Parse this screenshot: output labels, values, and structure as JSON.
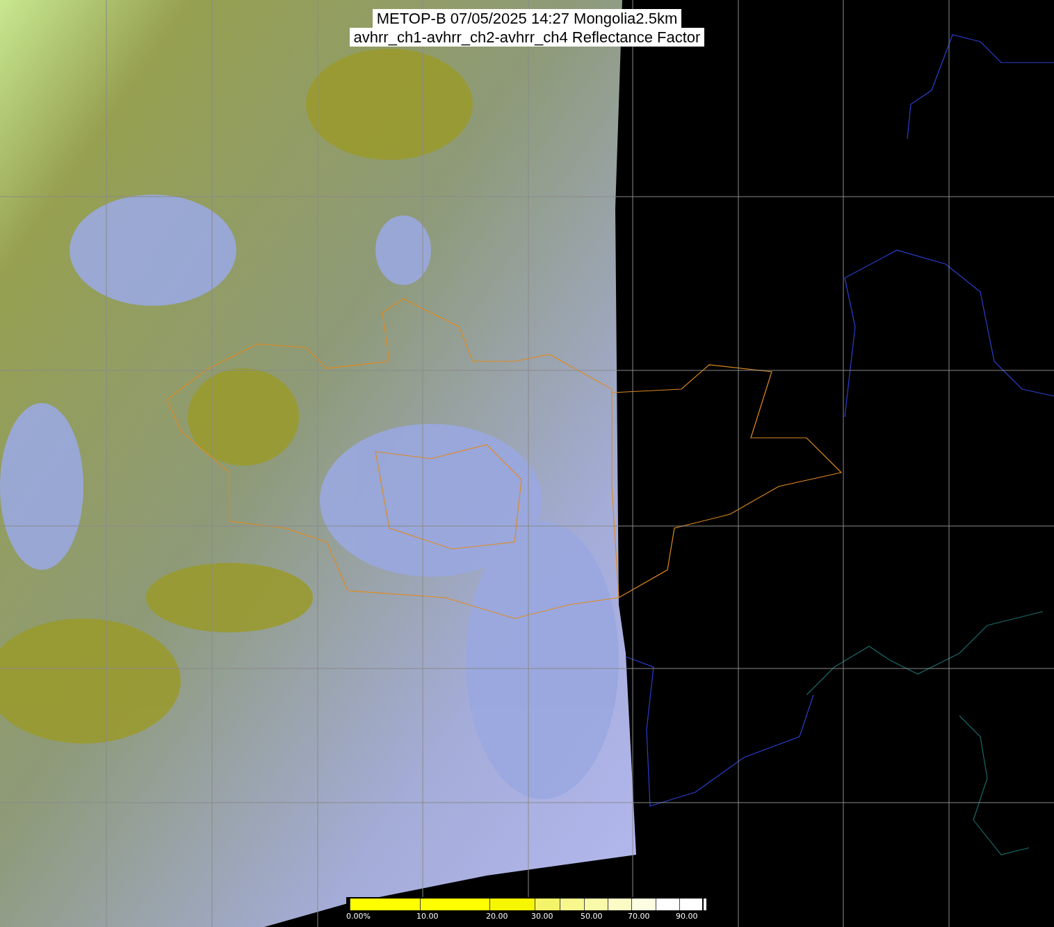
{
  "title": {
    "lines": [
      "METOP-B 07/05/2025 14:27 Mongolia2.5km",
      "avhrr_ch1-avhrr_ch2-avhrr_ch4 Reflectance Factor"
    ]
  },
  "colorbar": {
    "segments": [
      {
        "color": "#ffff00",
        "label": "0.00%"
      },
      {
        "color": "#ffff00",
        "label": "10.00"
      },
      {
        "color": "#f6f600",
        "label": "20.00"
      },
      {
        "color": "#f4f46a",
        "label": "30.00"
      },
      {
        "color": "#f7f78e"
      },
      {
        "color": "#f9f9aa",
        "label": "50.00"
      },
      {
        "color": "#fbfbc6"
      },
      {
        "color": "#fdfde2",
        "label": "70.00"
      },
      {
        "color": "#ffffff"
      },
      {
        "color": "#ffffff",
        "label": "90.00"
      }
    ]
  }
}
